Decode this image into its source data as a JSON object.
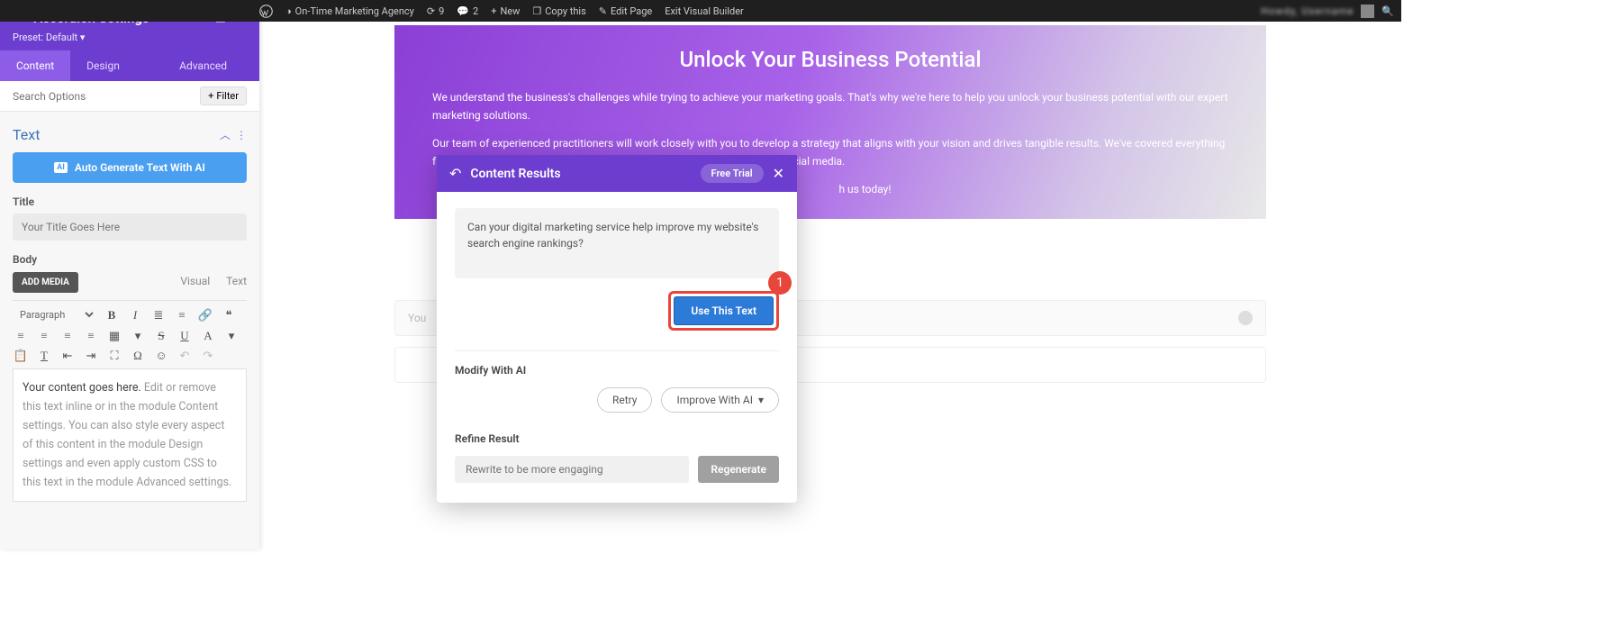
{
  "admin_bar": {
    "site_name": "On-Time Marketing Agency",
    "updates": "9",
    "comments": "2",
    "new": "New",
    "copy": "Copy this",
    "edit": "Edit Page",
    "exit": "Exit Visual Builder",
    "user": "Howdy, Username"
  },
  "panel": {
    "title": "Accordion Settings",
    "preset": "Preset: Default ▾",
    "tabs": {
      "content": "Content",
      "design": "Design",
      "advanced": "Advanced"
    },
    "search_placeholder": "Search Options",
    "filter": "Filter",
    "section": "Text",
    "ai_button": "Auto Generate Text With AI",
    "ai_badge": "AI",
    "title_label": "Title",
    "title_placeholder": "Your Title Goes Here",
    "body_label": "Body",
    "add_media": "ADD MEDIA",
    "editor_tabs": {
      "visual": "Visual",
      "text": "Text"
    },
    "paragraph": "Paragraph",
    "body_black": "Your content goes here.",
    "body_gray": " Edit or remove this text inline or in the module Content settings. You can also style every aspect of this content in the module Design settings and even apply custom CSS to this text in the module Advanced settings."
  },
  "hero": {
    "title": "Unlock Your Business Potential",
    "p1": "We understand the business's challenges while trying to achieve your marketing goals. That's why we're here to help you unlock your business potential with our expert marketing solutions.",
    "p2": "Our team of experienced practitioners will work closely with you to develop a strategy that aligns with your vision and drives tangible results. We've covered everything from analytics and content strategy to design, SEO, email marketing, and social media.",
    "p3_tail": "h us today!"
  },
  "placeholder_row": "You",
  "modal": {
    "title": "Content Results",
    "free_trial": "Free Trial",
    "result_text": "Can your digital marketing service help improve my website's search engine rankings?",
    "use_btn": "Use This Text",
    "annot": "1",
    "modify_label": "Modify With AI",
    "retry": "Retry",
    "improve": "Improve With AI",
    "refine_label": "Refine Result",
    "refine_placeholder": "Rewrite to be more engaging",
    "regenerate": "Regenerate"
  }
}
